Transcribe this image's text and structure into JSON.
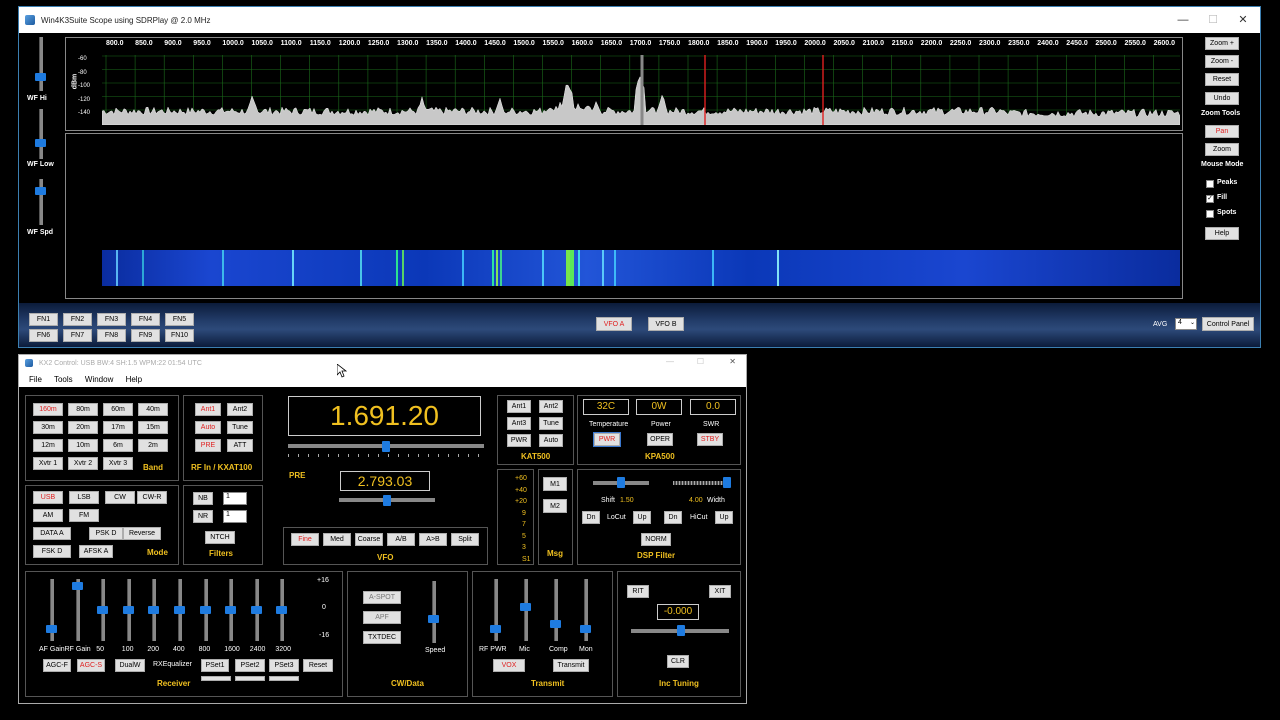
{
  "scope": {
    "title": "Win4K3Suite Scope using SDRPlay @ 2.0 MHz",
    "controls": {
      "minimize": "—",
      "maximize": "☐",
      "close": "✕"
    },
    "freq_ticks": [
      "800.0",
      "850.0",
      "900.0",
      "950.0",
      "1000.0",
      "1050.0",
      "1100.0",
      "1150.0",
      "1200.0",
      "1250.0",
      "1300.0",
      "1350.0",
      "1400.0",
      "1450.0",
      "1500.0",
      "1550.0",
      "1600.0",
      "1650.0",
      "1700.0",
      "1750.0",
      "1800.0",
      "1850.0",
      "1900.0",
      "1950.0",
      "2000.0",
      "2050.0",
      "2100.0",
      "2150.0",
      "2200.0",
      "2250.0",
      "2300.0",
      "2350.0",
      "2400.0",
      "2450.0",
      "2500.0",
      "2550.0",
      "2600.0"
    ],
    "dbm_label": "dBm",
    "dbm_ticks": [
      "-60",
      "-80",
      "-100",
      "-120",
      "-140"
    ],
    "sliders": [
      "WF Hi",
      "WF Low",
      "WF Spd"
    ],
    "right_buttons": {
      "zoom_in": "Zoom +",
      "zoom_out": "Zoom -",
      "reset": "Reset",
      "undo": "Undo",
      "pan": "Pan",
      "zoom": "Zoom",
      "help": "Help"
    },
    "zoom_tools_label": "Zoom Tools",
    "mouse_mode_label": "Mouse Mode",
    "checks": [
      {
        "label": "Peaks",
        "checked": false
      },
      {
        "label": "Fill",
        "checked": true
      },
      {
        "label": "Spots",
        "checked": false
      }
    ],
    "fn_buttons": [
      "FN1",
      "FN2",
      "FN3",
      "FN4",
      "FN5",
      "FN6",
      "FN7",
      "FN8",
      "FN9",
      "FN10"
    ],
    "vfo_a": "VFO A",
    "vfo_b": "VFO B",
    "avg_label": "AVG",
    "avg_value": "4",
    "control_panel": "Control Panel",
    "accent": "#e02020"
  },
  "kx2": {
    "title": "KX2 Control: USB BW:4 SH:1.5 WPM:22  01:54 UTC",
    "menu": [
      "File",
      "Tools",
      "Window",
      "Help"
    ],
    "bands": [
      "160m",
      "80m",
      "60m",
      "40m",
      "30m",
      "20m",
      "17m",
      "15m",
      "12m",
      "10m",
      "6m",
      "2m",
      "Xvtr 1",
      "Xvtr 2",
      "Xvtr 3"
    ],
    "band_label": "Band",
    "rf_buttons": [
      "Ant1",
      "Ant2",
      "Auto",
      "Tune",
      "PRE",
      "ATT"
    ],
    "rf_label": "RF In / KXAT100",
    "freq_main": "1.691.20",
    "pre_label": "PRE",
    "freq_sub": "2.793.03",
    "vfo_buttons": [
      "Fine",
      "Med",
      "Coarse",
      "A/B",
      "A>B",
      "Split"
    ],
    "vfo_label": "VFO",
    "kat_buttons": [
      "Ant1",
      "Ant2",
      "Ant3",
      "Tune",
      "PWR",
      "Auto"
    ],
    "kat_label": "KAT500",
    "kpa": {
      "temp": "32C",
      "power": "0W",
      "swr": "0.0",
      "temp_label": "Temperature",
      "power_label": "Power",
      "swr_label": "SWR",
      "pwr": "PWR",
      "oper": "OPER",
      "stby": "STBY",
      "label": "KPA500"
    },
    "modes": [
      "USB",
      "LSB",
      "CW",
      "CW-R",
      "AM",
      "FM",
      "DATA A",
      "PSK D",
      "Reverse",
      "FSK D",
      "AFSK A"
    ],
    "mode_label": "Mode",
    "filters": {
      "nb": "NB",
      "nr": "NR",
      "nb_val": "1",
      "nr_val": "1",
      "ntch": "NTCH",
      "label": "Filters"
    },
    "smeter": [
      "+60",
      "+40",
      "+20",
      "9",
      "7",
      "5",
      "3",
      "S1"
    ],
    "msg": {
      "m1": "M1",
      "m2": "M2",
      "label": "Msg"
    },
    "dsp": {
      "shift": "Shift",
      "shift_val": "1.50",
      "width_val": "4.00",
      "width": "Width",
      "dn": "Dn",
      "up": "Up",
      "locut": "LoCut",
      "hicut": "HiCut",
      "norm": "NORM",
      "label": "DSP Filter"
    },
    "receiver": {
      "sliders": [
        "AF Gain",
        "RF Gain",
        "50",
        "100",
        "200",
        "400",
        "800",
        "1600",
        "2400",
        "3200"
      ],
      "scale": [
        "+16",
        "0",
        "-16"
      ],
      "eq_label": "RXEqualizer",
      "buttons": [
        "AGC-F",
        "AGC-S",
        "DualW",
        "PSet1",
        "PSet2",
        "PSet3",
        "Reset"
      ],
      "label": "Receiver"
    },
    "cw": {
      "aspot": "A-SPOT",
      "apf": "APF",
      "txtdec": "TXTDEC",
      "speed": "Speed",
      "label": "CW/Data"
    },
    "transmit": {
      "sliders": [
        "RF PWR",
        "Mic",
        "Comp",
        "Mon"
      ],
      "vox": "VOX",
      "transmit": "Transmit",
      "label": "Transmit"
    },
    "inc": {
      "rit": "RIT",
      "xit": "XIT",
      "value": "-0.000",
      "clr": "CLR",
      "label": "Inc Tuning"
    }
  }
}
